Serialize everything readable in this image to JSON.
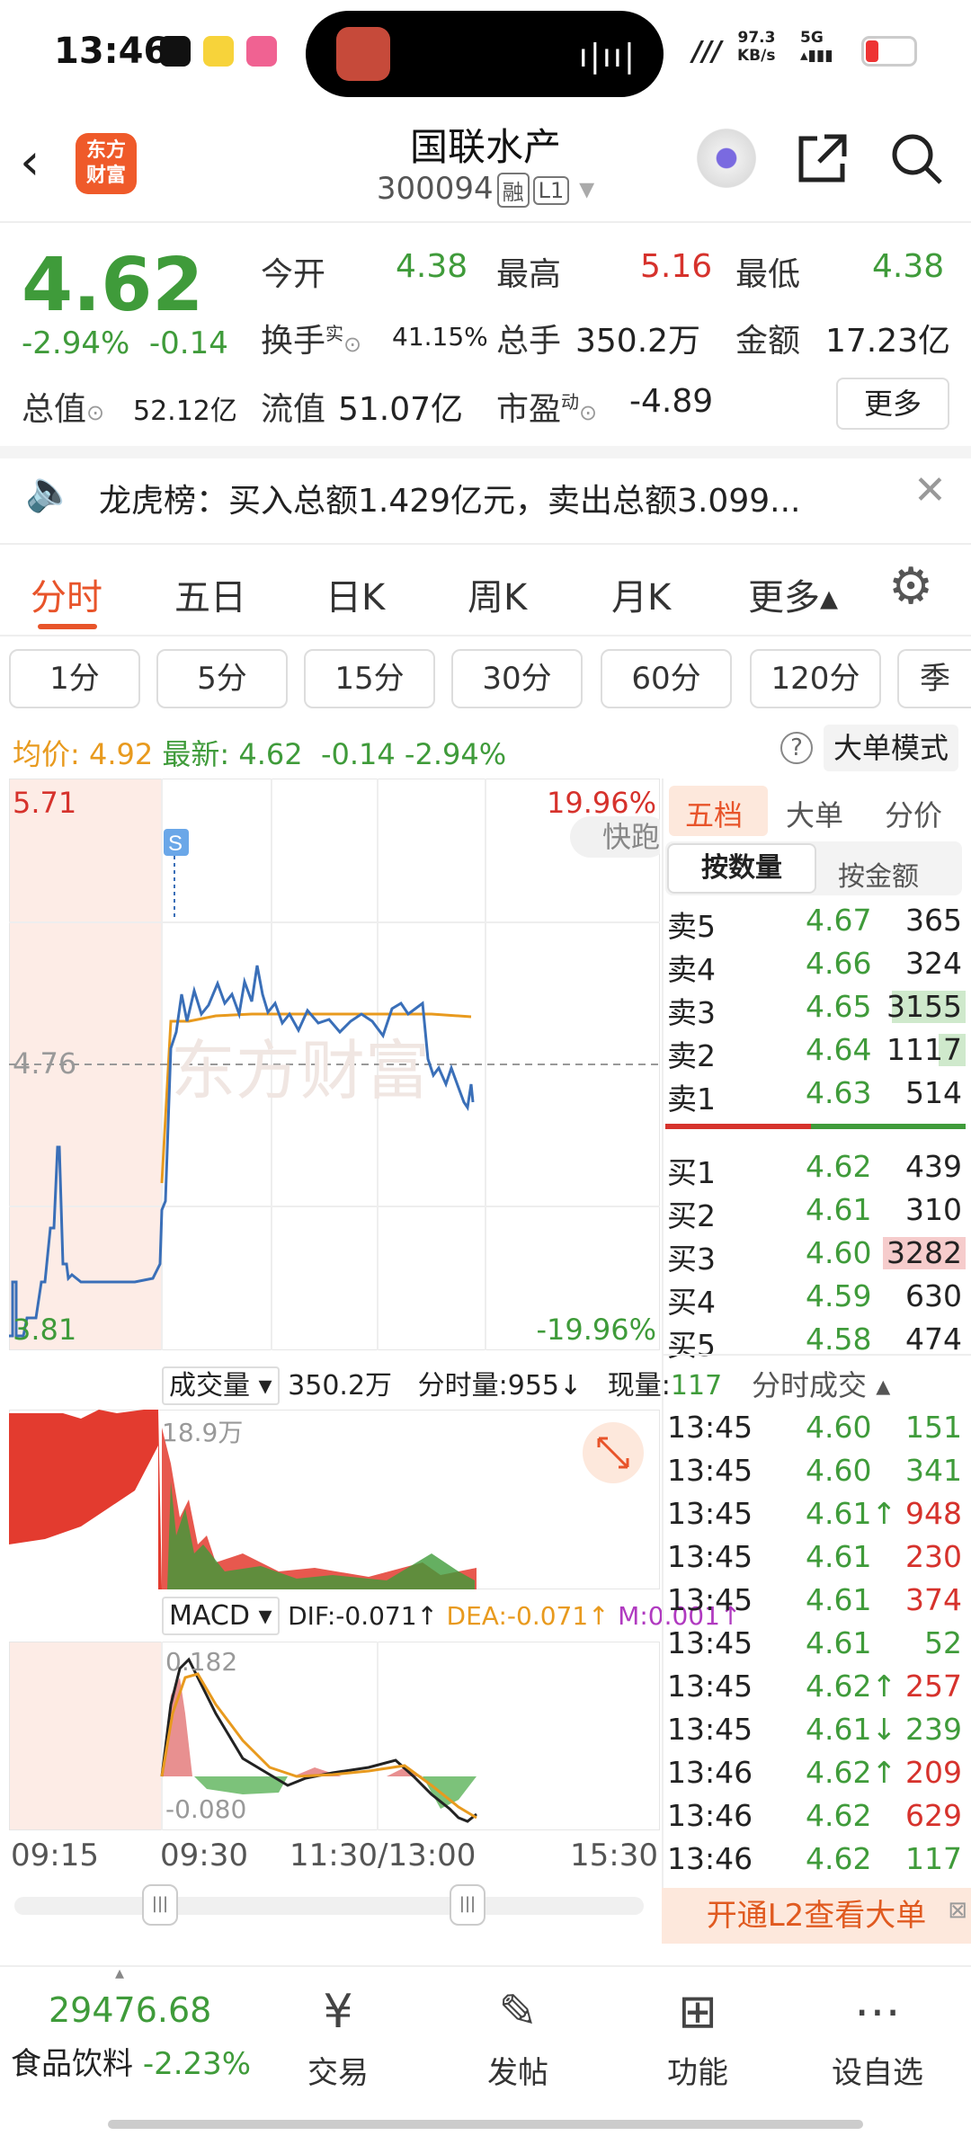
{
  "status_bar": {
    "time": "13:46",
    "net_speed": "97.3",
    "net_unit": "KB/s",
    "signal": "5G"
  },
  "header": {
    "title": "国联水产",
    "code": "300094",
    "tag1": "融",
    "tag2": "L1",
    "logo_line1": "东方",
    "logo_line2": "财富"
  },
  "quote": {
    "price": "4.62",
    "pct": "-2.94%",
    "chg": "-0.14",
    "open_label": "今开",
    "open": "4.38",
    "high_label": "最高",
    "high": "5.16",
    "low_label": "最低",
    "low": "4.38",
    "turnover_label": "换手",
    "turnover_sup": "实",
    "turnover": "41.15%",
    "vol_label": "总手",
    "vol": "350.2万",
    "amt_label": "金额",
    "amt": "17.23亿",
    "mcap_label": "总值",
    "mcap": "52.12亿",
    "float_label": "流值",
    "float": "51.07亿",
    "pe_label": "市盈",
    "pe_sup": "动",
    "pe": "-4.89",
    "more": "更多"
  },
  "news": {
    "text": "龙虎榜：买入总额1.429亿元，卖出总额3.099..."
  },
  "tabs": [
    "分时",
    "五日",
    "日K",
    "周K",
    "月K",
    "更多▴"
  ],
  "periods": [
    "1分",
    "5分",
    "15分",
    "30分",
    "60分",
    "120分",
    "季"
  ],
  "avg_line": {
    "avg_label": "均价:",
    "avg": "4.92",
    "last_label": "最新:",
    "last": "4.62",
    "chg": "-0.14",
    "pct": "-2.94%",
    "big_order": "大单模式"
  },
  "chart": {
    "ymax": "5.71",
    "ymid": "4.76",
    "ymin": "3.81",
    "pmax": "19.96%",
    "pmin": "-19.96%",
    "watermark": "东方财富",
    "signal": "S",
    "quick": "快跑"
  },
  "volume": {
    "label": "成交量",
    "total": "350.2万",
    "tick_label": "分时量:955↓",
    "cur_label": "现量:",
    "cur": "117",
    "max": "18.9万"
  },
  "macd": {
    "label": "MACD",
    "dif": "DIF:-0.071↑",
    "dea": "DEA:-0.071↑",
    "m": "M:0.001↑",
    "top": "0.182",
    "bottom": "-0.080"
  },
  "xaxis": [
    "09:15",
    "09:30",
    "11:30/13:00",
    "15:30"
  ],
  "right_panel": {
    "tabs": [
      "五档",
      "大单",
      "分价"
    ],
    "sub_tabs": [
      "按数量",
      "按金额"
    ],
    "sell": [
      {
        "name": "卖5",
        "price": "4.67",
        "vol": "365"
      },
      {
        "name": "卖4",
        "price": "4.66",
        "vol": "324"
      },
      {
        "name": "卖3",
        "price": "4.65",
        "vol": "3155"
      },
      {
        "name": "卖2",
        "price": "4.64",
        "vol": "1117"
      },
      {
        "name": "卖1",
        "price": "4.63",
        "vol": "514"
      }
    ],
    "buy": [
      {
        "name": "买1",
        "price": "4.62",
        "vol": "439"
      },
      {
        "name": "买2",
        "price": "4.61",
        "vol": "310"
      },
      {
        "name": "买3",
        "price": "4.60",
        "vol": "3282"
      },
      {
        "name": "买4",
        "price": "4.59",
        "vol": "630"
      },
      {
        "name": "买5",
        "price": "4.58",
        "vol": "474"
      }
    ],
    "trades_title": "分时成交",
    "trades": [
      {
        "t": "13:45",
        "p": "4.60",
        "v": "151",
        "arrow": ""
      },
      {
        "t": "13:45",
        "p": "4.60",
        "v": "341",
        "arrow": ""
      },
      {
        "t": "13:45",
        "p": "4.61↑",
        "v": "948",
        "arrow": "up"
      },
      {
        "t": "13:45",
        "p": "4.61",
        "v": "230",
        "arrow": ""
      },
      {
        "t": "13:45",
        "p": "4.61",
        "v": "374",
        "arrow": ""
      },
      {
        "t": "13:45",
        "p": "4.61",
        "v": "52",
        "arrow": ""
      },
      {
        "t": "13:45",
        "p": "4.62↑",
        "v": "257",
        "arrow": "up"
      },
      {
        "t": "13:45",
        "p": "4.61↓",
        "v": "239",
        "arrow": "down"
      },
      {
        "t": "13:46",
        "p": "4.62↑",
        "v": "209",
        "arrow": "up"
      },
      {
        "t": "13:46",
        "p": "4.62",
        "v": "629",
        "arrow": ""
      },
      {
        "t": "13:46",
        "p": "4.62",
        "v": "117",
        "arrow": ""
      }
    ],
    "l2": "开通L2查看大单"
  },
  "bottom": {
    "index": "29476.68",
    "sector": "食品饮料",
    "sector_pct": "-2.23%",
    "items": [
      "交易",
      "发帖",
      "功能",
      "设自选"
    ]
  },
  "colors": {
    "up": "#d6322c",
    "down": "#3f9b3a",
    "accent": "#e8542a"
  }
}
